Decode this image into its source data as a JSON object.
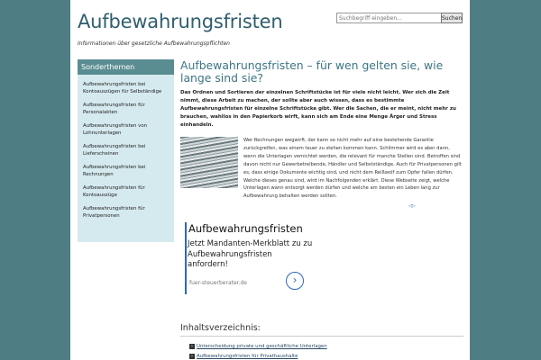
{
  "header": {
    "site_title": "Aufbewahrungsfristen",
    "tagline": "Informationen über gesetzliche Aufbewahrungspflichten"
  },
  "search": {
    "placeholder": "Suchbegriff eingeben...",
    "button_label": "Suchen"
  },
  "sidebar": {
    "heading": "Sonderthemen",
    "items": [
      "Aufbewahrungsfristen bei Kontoauszügen für Selbständige",
      "Aufbewahrungsfristen für Personalakten",
      "Aufbewahrungsfristen von Lohnunterlagen",
      "Aufbewahrungsfristen bei Lieferscheinen",
      "Aufbewahrungsfristen bei Rechnungen",
      "Aufbewahrungsfristen für Kontoauszüge",
      "Aufbewahrungsfristen für Privatpersonen"
    ]
  },
  "article": {
    "title": "Aufbewahrungsfristen – für wen gelten sie, wie lange sind sie?",
    "intro": "Das Ordnen und Sortieren der einzelnen Schriftstücke ist für viele nicht leicht. Wer sich die Zeit nimmt, diese Arbeit zu machen, der sollte aber auch wissen, dass es bestimmte Aufbewahrungsfristen für einzelne Schriftstücke gibt. Wer die Sachen, die er meint, nicht mehr zu brauchen, wahllos in den Papierkorb wirft, kann sich am Ende eine Menge Ärger und Stress einhandeln.",
    "body": "Wer Rechnungen wegwirft, der kann so nicht mehr auf eine bestehende Garantie zurückgreifen, was einem teuer zu stehen kommen kann. Schlimmer wird es aber dann, wenn die Unterlagen vernichtet werden, die relevant für manche Stellen sind. Betroffen sind davon nicht nur Gewerbetreibende, Händler und Selbstständige. Auch für Privatpersonen gilt es, dass einige Dokumente wichtig sind, und nicht dem Reißwolf zum Opfer fallen dürfen. Welche dieses genau sind, wird im Nachfolgenden erklärt. Diese Webseite zeigt, welche Unterlagen wann entsorgt werden dürfen und welche am besten ein Leben lang zur Aufbewahrung behalten werden sollten."
  },
  "ad": {
    "title": "Aufbewahrungsfristen",
    "text": "Jetzt Mandanten-Merkblatt zu zu Aufbewahrungsfristen anfordern!",
    "domain": "fuer-steuerberater.de",
    "arrow": "›",
    "choices_icon": "ad-choices-icon"
  },
  "toc": {
    "title": "Inhaltsverzeichnis:",
    "items": [
      "Unterscheidung private und geschäftliche Unterlagen",
      "Aufbewahrungsfristen für Privathaushalte"
    ]
  },
  "colors": {
    "background": "#4e7e84",
    "sidebar_head": "#5a8d92",
    "sidebar_bg": "#d5eaee",
    "title": "#3d7585",
    "ad_accent": "#2b68c0"
  }
}
